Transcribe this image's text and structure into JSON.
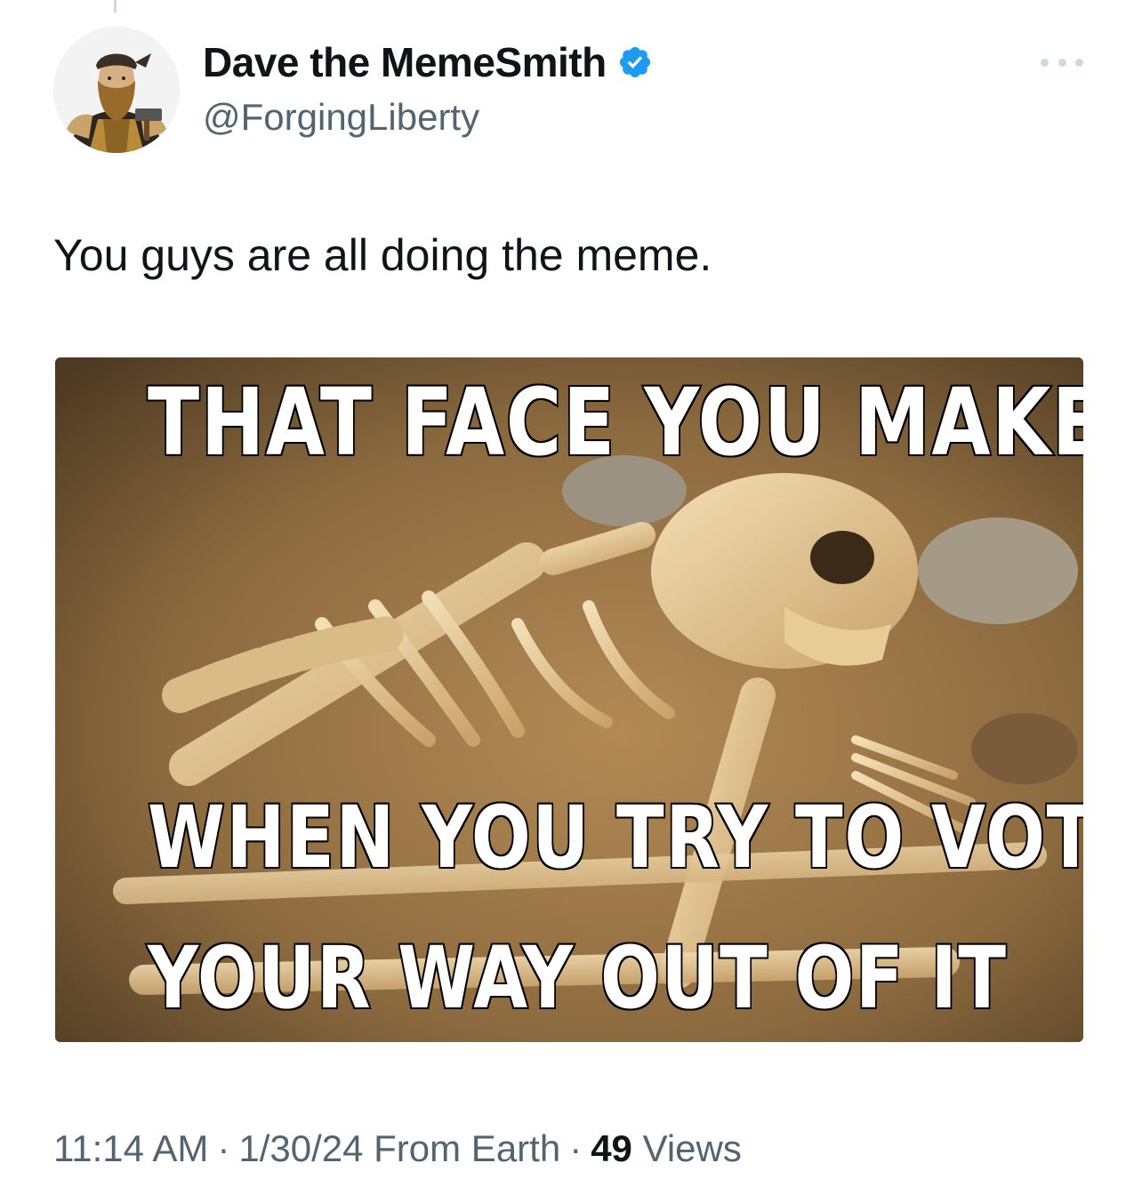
{
  "author": {
    "display_name": "Dave the MemeSmith",
    "handle": "@ForgingLiberty",
    "verified": true,
    "avatar_icon": "blacksmith-portrait",
    "verified_color": "#1d9bf0"
  },
  "tweet": {
    "text": "You guys are all doing the meme."
  },
  "media": {
    "top_caption": "THAT FACE YOU MAKE",
    "bottom_caption_line1": "WHEN YOU TRY TO VOTE",
    "bottom_caption_line2": "YOUR WAY OUT OF IT"
  },
  "meta": {
    "time": "11:14 AM",
    "separator": "·",
    "date": "1/30/24",
    "source": "From Earth",
    "views_count": "49",
    "views_label": "Views"
  },
  "icons": {
    "more": "more-options-icon",
    "verified": "verified-badge-icon"
  }
}
